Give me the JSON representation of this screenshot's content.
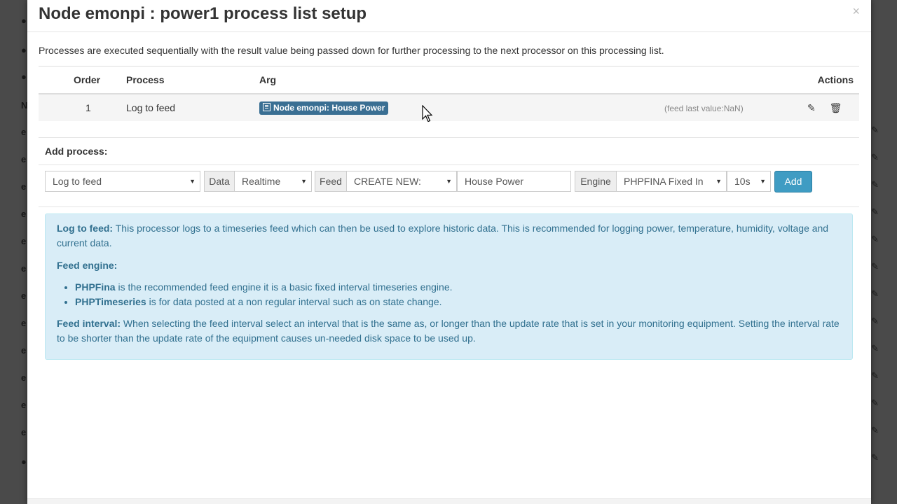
{
  "modal": {
    "title": "Node emonpi : power1 process list setup",
    "close": "×",
    "intro": "Processes are executed sequentially with the result value being passed down for further processing to the next processor on this processing list."
  },
  "table": {
    "headers": {
      "order": "Order",
      "process": "Process",
      "arg": "Arg",
      "actions": "Actions"
    },
    "rows": [
      {
        "order": "1",
        "process": "Log to feed",
        "arg": "Node emonpi: House Power",
        "last_value": "(feed last value:NaN)"
      }
    ]
  },
  "add_process": {
    "title": "Add process:",
    "process_select": "Log to feed",
    "data_label": "Data",
    "data_select": "Realtime",
    "feed_label": "Feed",
    "feed_select": "CREATE NEW:",
    "feed_name": "House Power",
    "engine_label": "Engine",
    "engine_select": "PHPFINA Fixed In",
    "interval_select": "10s",
    "add_button": "Add"
  },
  "info": {
    "log_title": "Log to feed:",
    "log_text": " This processor logs to a timeseries feed which can then be used to explore historic data. This is recommended for logging power, temperature, humidity, voltage and current data.",
    "engine_title": "Feed engine:",
    "engines": [
      {
        "name": "PHPFina",
        "text": " is the recommended feed engine it is a basic fixed interval timeseries engine."
      },
      {
        "name": "PHPTimeseries",
        "text": " is for data posted at a non regular interval such as on state change."
      }
    ],
    "interval_title": "Feed interval:",
    "interval_text": " When selecting the feed interval select an interval that is the same as, or longer than the update rate that is set in your monitoring equipment. Setting the interval rate to be shorter than the update rate of the equipment causes un-needed disk space to be used up."
  },
  "background": {
    "left_glyphs": [
      "●",
      "●",
      "●",
      "N",
      "e",
      "e",
      "e",
      "e",
      "e",
      "e",
      "e",
      "e",
      "e",
      "e",
      "e",
      "e",
      "●"
    ],
    "right_glyph": "✎"
  }
}
